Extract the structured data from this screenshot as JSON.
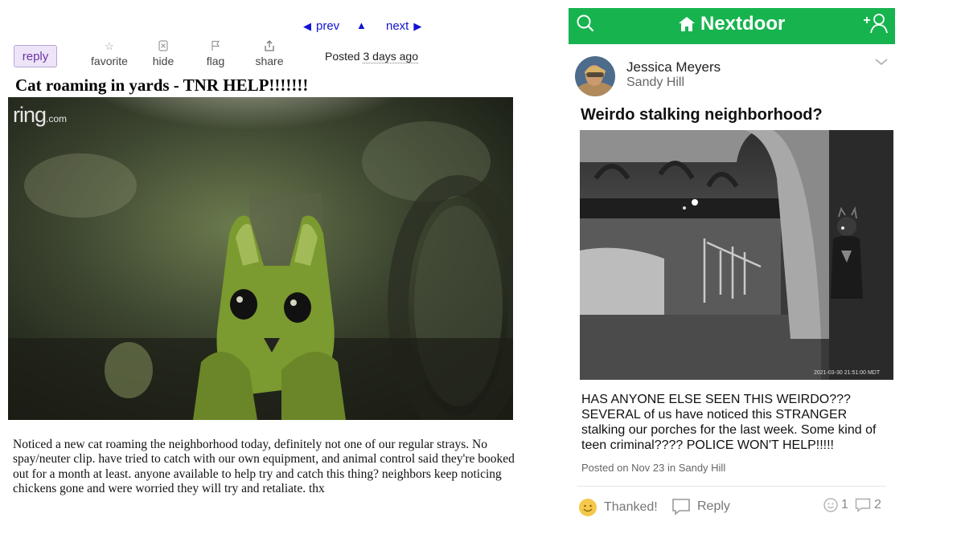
{
  "listing": {
    "nav": {
      "prev": "prev",
      "up": "▲",
      "next": "next"
    },
    "reply_label": "reply",
    "actions": [
      {
        "label": "favorite",
        "icon": "star-icon"
      },
      {
        "label": "hide",
        "icon": "hide-icon"
      },
      {
        "label": "flag",
        "icon": "flag-icon"
      },
      {
        "label": "share",
        "icon": "share-icon"
      }
    ],
    "posted_prefix": "Posted",
    "posted_when": "3 days ago",
    "title": "Cat roaming in yards - TNR HELP!!!!!!!",
    "image_logo": "ring",
    "image_logo_suffix": ".com",
    "body": "Noticed a new cat roaming the neighborhood today, definitely not one of our regular strays. No spay/neuter clip. have tried to catch with our own equipment, and animal control said they're booked out for a month at least. anyone available to help try and catch this thing? neighbors keep noticing chickens gone and were worried they will try and retaliate. thx"
  },
  "nextdoor": {
    "brand": "Nextdoor",
    "brand_color": "#17b34f",
    "author": "Jessica Meyers",
    "neighborhood": "Sandy Hill",
    "title": "Weirdo stalking neighborhood?",
    "image_timestamp": "2021-03-30 21:51:00 MDT",
    "body": "HAS ANYONE ELSE SEEN THIS WEIRDO??? SEVERAL of us have noticed this STRANGER stalking our porches for the last week. Some kind of teen criminal???? POLICE WON'T HELP!!!!!",
    "posted_meta": "Posted on Nov 23 in Sandy Hill",
    "thanked_label": "Thanked!",
    "reply_label": "Reply",
    "reaction_count": "1",
    "comment_count": "2"
  }
}
